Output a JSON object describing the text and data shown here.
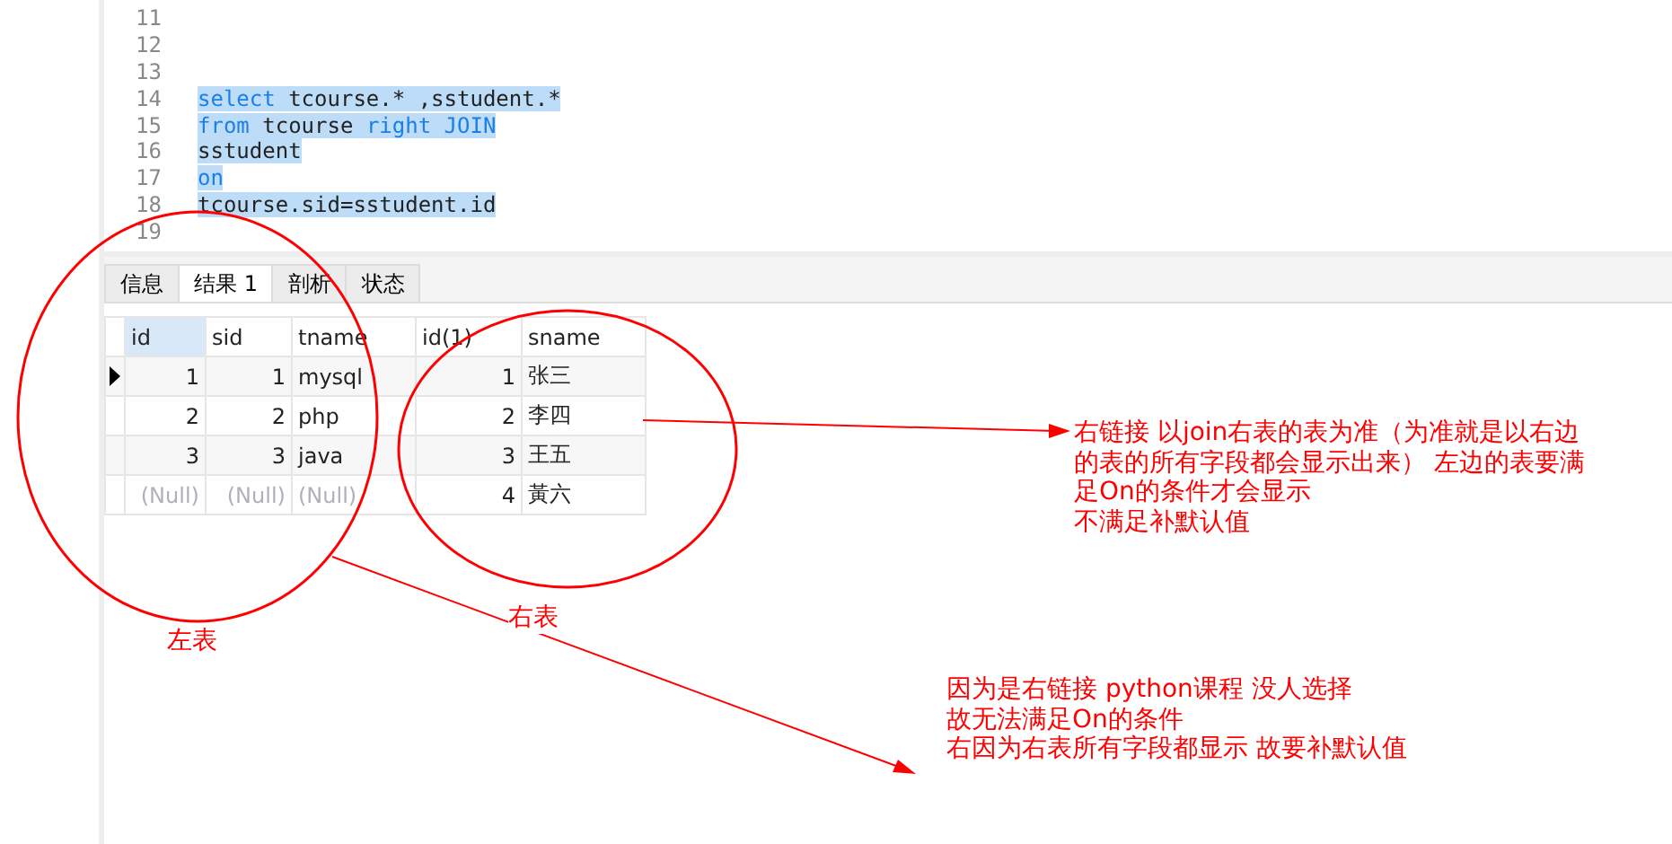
{
  "editor": {
    "lines": [
      {
        "number": "11",
        "selected": false
      },
      {
        "number": "12",
        "selected": false
      },
      {
        "number": "13",
        "selected": false
      },
      {
        "number": "14",
        "selected": true,
        "tokens": [
          {
            "kind": "keyword",
            "text": "select"
          },
          {
            "kind": "plain",
            "text": " tcourse.* ,sstudent.*"
          }
        ]
      },
      {
        "number": "15",
        "selected": true,
        "tokens": [
          {
            "kind": "keyword",
            "text": "from"
          },
          {
            "kind": "plain",
            "text": " tcourse "
          },
          {
            "kind": "keyword",
            "text": "right JOIN"
          }
        ]
      },
      {
        "number": "16",
        "selected": true,
        "tokens": [
          {
            "kind": "plain",
            "text": "sstudent"
          }
        ]
      },
      {
        "number": "17",
        "selected": true,
        "tokens": [
          {
            "kind": "keyword",
            "text": "on"
          }
        ]
      },
      {
        "number": "18",
        "selected": true,
        "tokens": [
          {
            "kind": "plain",
            "text": "tcourse.sid=sstudent.id"
          }
        ]
      },
      {
        "number": "19",
        "selected": false
      }
    ]
  },
  "result_tabs": [
    {
      "label": "信息",
      "selected": false
    },
    {
      "label": "结果 1",
      "selected": true
    },
    {
      "label": "剖析",
      "selected": false
    },
    {
      "label": "状态",
      "selected": false
    }
  ],
  "grid": {
    "columns": [
      {
        "label": "id",
        "selected": true
      },
      {
        "label": "sid",
        "selected": false
      },
      {
        "label": "tname",
        "selected": false
      },
      {
        "label": "id(1)",
        "selected": false
      },
      {
        "label": "sname",
        "selected": false
      }
    ],
    "rows": [
      {
        "current": true,
        "cells": [
          {
            "text": "1",
            "null": false
          },
          {
            "text": "1",
            "null": false
          },
          {
            "text": "mysql",
            "null": false
          },
          {
            "text": "1",
            "null": false
          },
          {
            "text": "张三",
            "null": false
          }
        ]
      },
      {
        "current": false,
        "cells": [
          {
            "text": "2",
            "null": false
          },
          {
            "text": "2",
            "null": false
          },
          {
            "text": "php",
            "null": false
          },
          {
            "text": "2",
            "null": false
          },
          {
            "text": "李四",
            "null": false
          }
        ]
      },
      {
        "current": false,
        "cells": [
          {
            "text": "3",
            "null": false
          },
          {
            "text": "3",
            "null": false
          },
          {
            "text": "java",
            "null": false
          },
          {
            "text": "3",
            "null": false
          },
          {
            "text": "王五",
            "null": false
          }
        ]
      },
      {
        "current": false,
        "cells": [
          {
            "text": "(Null)",
            "null": true
          },
          {
            "text": "(Null)",
            "null": true
          },
          {
            "text": "(Null)",
            "null": true
          },
          {
            "text": "4",
            "null": false
          },
          {
            "text": "黃六",
            "null": false
          }
        ]
      }
    ]
  },
  "annotations": {
    "right_join_note": [
      "右链接 以join右表的表为准（为准就是以右边",
      "的表的所有字段都会显示出来） 左边的表要满",
      "足On的条件才会显示",
      "不满足补默认值"
    ],
    "left_table_label": "左表",
    "right_table_label": "右表",
    "python_note": [
      "因为是右链接  python课程 没人选择",
      "故无法满足On的条件",
      "右因为右表所有字段都显示  故要补默认值"
    ]
  }
}
